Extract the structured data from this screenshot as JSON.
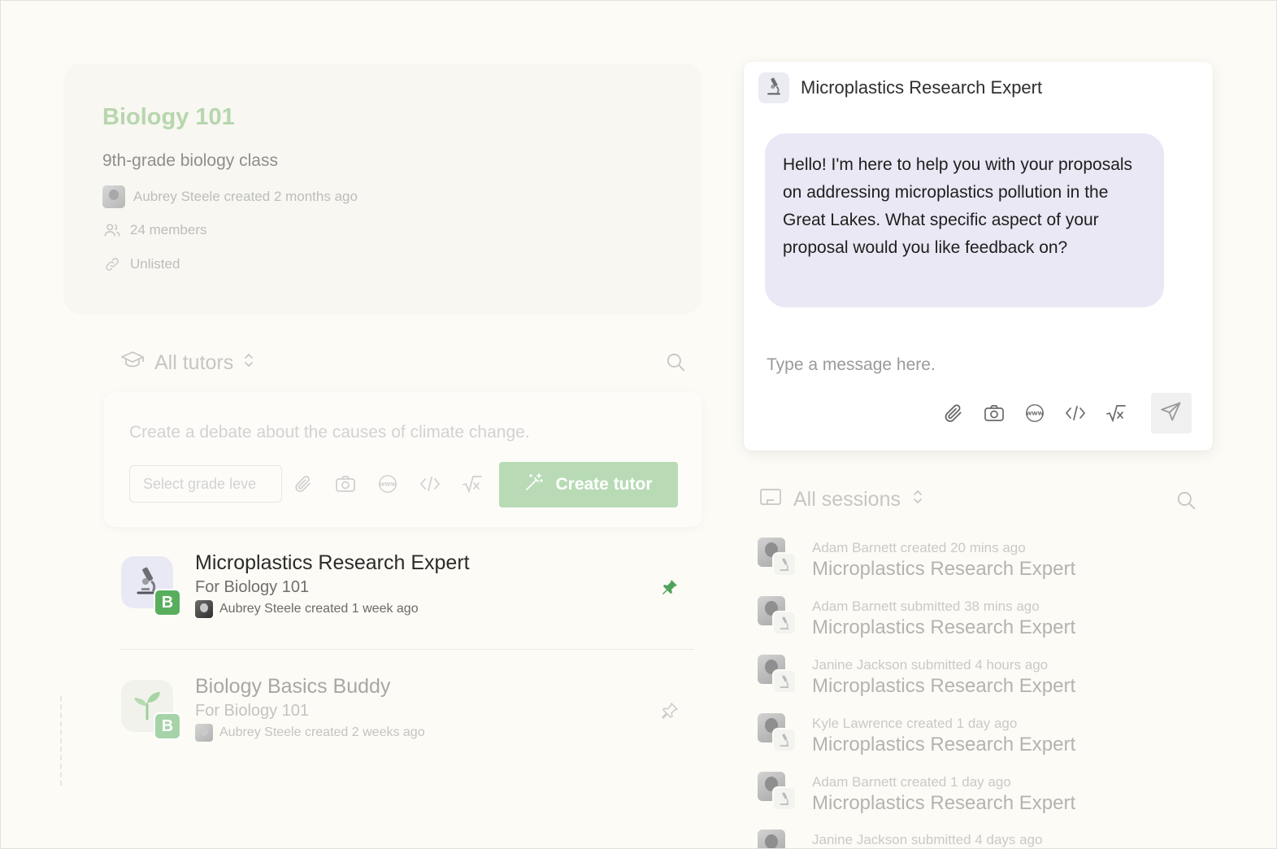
{
  "course": {
    "title": "Biology 101",
    "subtitle": "9th-grade biology class",
    "created": "Aubrey Steele created 2 months ago",
    "members": "24 members",
    "visibility": "Unlisted"
  },
  "tutors": {
    "filter_label": "All tutors",
    "composer_placeholder": "Create a debate about the causes of climate change.",
    "grade_select_value": "Select grade leve",
    "create_label": "Create tutor",
    "items": [
      {
        "name": "Microplastics Research Expert",
        "for": "For Biology 101",
        "meta": "Aubrey Steele created 1 week ago",
        "badge": "B",
        "pinned": true
      },
      {
        "name": "Biology Basics Buddy",
        "for": "For Biology 101",
        "meta": "Aubrey Steele created 2 weeks ago",
        "badge": "B",
        "pinned": false
      }
    ]
  },
  "chat": {
    "title": "Microplastics Research Expert",
    "message": "Hello! I'm here to help you with your proposals on addressing microplastics pollution in the Great Lakes. What specific aspect of your proposal would you like feedback on?",
    "input_placeholder": "Type a message here."
  },
  "sessions": {
    "filter_label": "All sessions",
    "items": [
      {
        "meta": "Adam Barnett created 20 mins ago",
        "name": "Microplastics Research Expert"
      },
      {
        "meta": "Adam Barnett submitted 38 mins ago",
        "name": "Microplastics Research Expert"
      },
      {
        "meta": "Janine Jackson submitted 4 hours ago",
        "name": "Microplastics Research Expert"
      },
      {
        "meta": "Kyle Lawrence created 1 day ago",
        "name": "Microplastics Research Expert"
      },
      {
        "meta": "Adam Barnett created 1 day ago",
        "name": "Microplastics Research Expert"
      },
      {
        "meta": "Janine Jackson submitted 4 days ago",
        "name": ""
      }
    ]
  },
  "colors": {
    "accent_green": "#59ae5e",
    "create_button": "#b8dbb6",
    "bubble": "#e9e8f4",
    "background": "#fdfbf5"
  },
  "icons": [
    "graduation-cap-icon",
    "chevron-updown-icon",
    "search-icon",
    "paperclip-icon",
    "camera-icon",
    "www-icon",
    "code-icon",
    "sqrt-icon",
    "magic-wand-icon",
    "microscope-icon",
    "sprout-icon",
    "pin-icon",
    "send-icon",
    "users-icon",
    "link-icon",
    "monitor-icon"
  ]
}
